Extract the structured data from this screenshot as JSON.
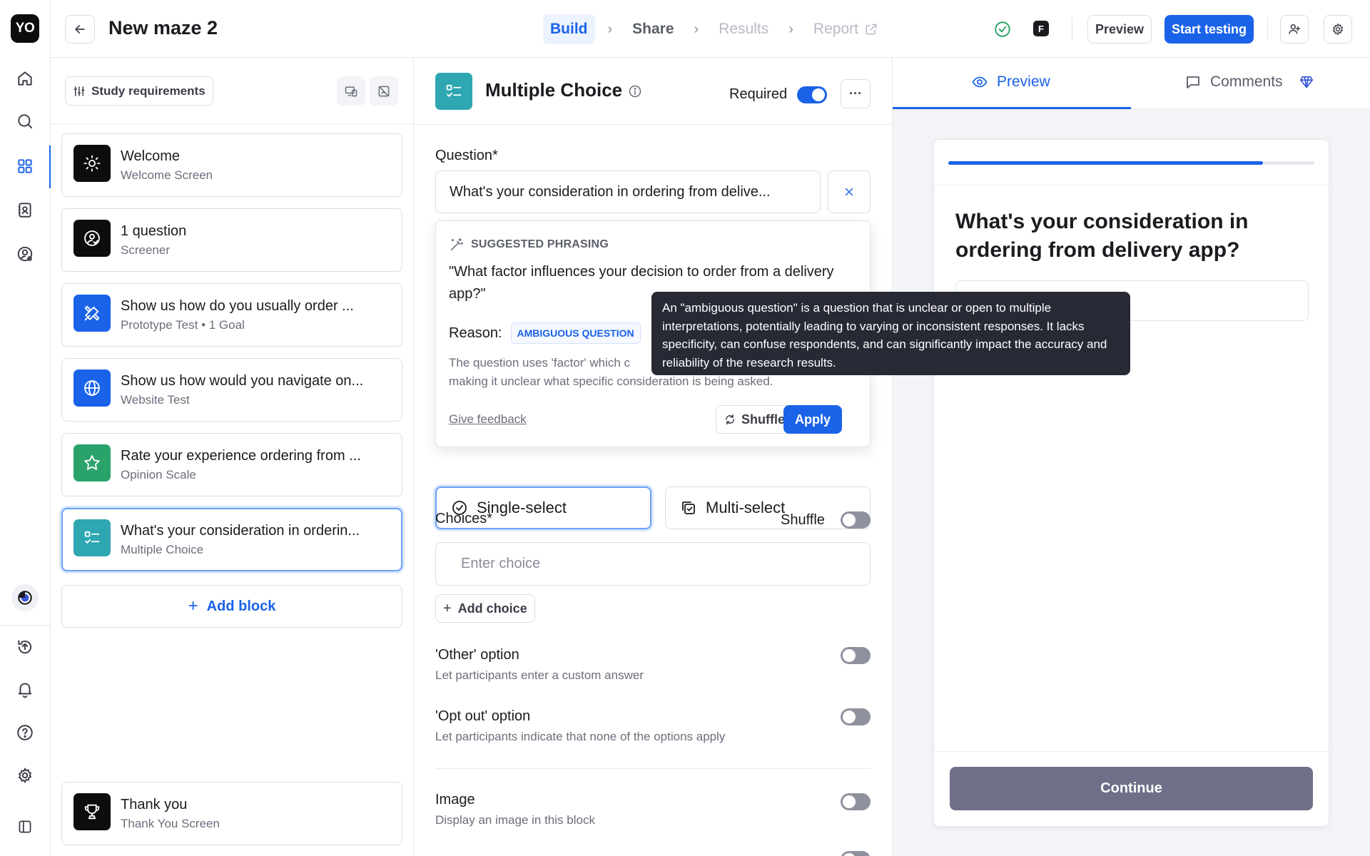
{
  "app": {
    "logo": "YO",
    "accent_color": "#1a62e8"
  },
  "rail": {
    "items": [
      {
        "name": "home-icon"
      },
      {
        "name": "search-icon"
      },
      {
        "name": "grid-icon",
        "active": true
      },
      {
        "name": "contacts-icon"
      },
      {
        "name": "user-settings-icon"
      },
      {
        "name": "activity-icon"
      },
      {
        "name": "upload-icon"
      },
      {
        "name": "bell-icon"
      },
      {
        "name": "help-icon"
      },
      {
        "name": "gear-icon"
      },
      {
        "name": "sidebar-toggle-icon"
      }
    ]
  },
  "topbar": {
    "title": "New maze 2",
    "steps": [
      {
        "label": "Build",
        "state": "active"
      },
      {
        "label": "Share",
        "state": "normal"
      },
      {
        "label": "Results",
        "state": "disabled"
      },
      {
        "label": "Report",
        "state": "disabled"
      }
    ],
    "preview_label": "Preview",
    "start_label": "Start testing",
    "figma_glyph": "F"
  },
  "blocks_panel": {
    "requirements_label": "Study requirements",
    "cards": [
      {
        "title": "Welcome",
        "subtitle": "Welcome Screen",
        "icon": "sun-icon",
        "color": "#0d0d10"
      },
      {
        "title": "1 question",
        "subtitle": "Screener",
        "icon": "user-check-icon",
        "color": "#0d0d10"
      },
      {
        "title": "Show us how do you usually order ...",
        "subtitle": "Prototype Test • 1 Goal",
        "icon": "tools-icon",
        "color": "#1a62e8"
      },
      {
        "title": "Show us how would you navigate on...",
        "subtitle": "Website Test",
        "icon": "globe-icon",
        "color": "#1a62e8"
      },
      {
        "title": "Rate your experience ordering from ...",
        "subtitle": "Opinion Scale",
        "icon": "star-icon",
        "color": "#2aa36b"
      },
      {
        "title": "What's your consideration in orderin...",
        "subtitle": "Multiple Choice",
        "icon": "list-check-icon",
        "color": "#2fa7b3",
        "selected": true
      }
    ],
    "add_block_label": "Add block",
    "thank_you": {
      "title": "Thank you",
      "subtitle": "Thank You Screen",
      "icon": "trophy-icon",
      "color": "#0d0d10"
    }
  },
  "editor": {
    "title": "Multiple Choice",
    "required_label": "Required",
    "required_on": true,
    "more_label": "···",
    "question_label": "Question*",
    "question_value": "What's your consideration in ordering from delive...",
    "suggestion": {
      "heading": "SUGGESTED PHRASING",
      "text": "\"What factor influences your decision to order from a delivery app?\"",
      "reason_label": "Reason:",
      "reason_badge": "AMBIGUOUS QUESTION",
      "description": "The question uses 'factor' which c... making it unclear what specific consideration is being asked.",
      "description_line1": "The question uses 'factor' which c",
      "description_line2": "making it unclear what specific consideration is being asked.",
      "feedback_label": "Give feedback",
      "shuffle_label": "Shuffle",
      "apply_label": "Apply"
    },
    "single_select_label": "Single-select",
    "multi_select_label": "Multi-select",
    "choices_label": "Choices*",
    "shuffle_label": "Shuffle",
    "choice_placeholder": "Enter choice",
    "add_choice_label": "Add choice",
    "options": [
      {
        "title": "'Other' option",
        "subtitle": "Let participants enter a custom answer"
      },
      {
        "title": "'Opt out' option",
        "subtitle": "Let participants indicate that none of the options apply"
      },
      {
        "title": "Image",
        "subtitle": "Display an image in this block"
      }
    ]
  },
  "tooltip": {
    "text": "An \"ambiguous question\" is a question that is unclear or open to multiple interpretations, potentially leading to varying or inconsistent responses. It lacks specificity, can confuse respondents, and can significantly impact the accuracy and reliability of the research results."
  },
  "preview_panel": {
    "tab_preview": "Preview",
    "tab_comments": "Comments",
    "progress": 0.86,
    "question": "What's your consideration in ordering from delivery app?",
    "continue_label": "Continue"
  }
}
